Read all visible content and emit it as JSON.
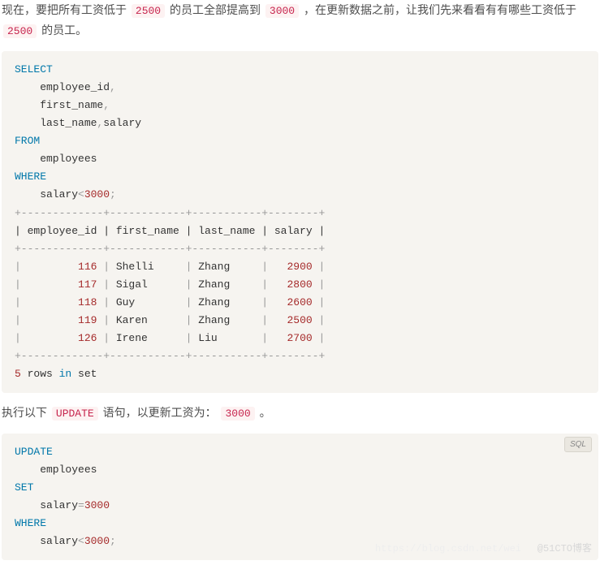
{
  "para1": {
    "t1": "现在，要把所有工资低于 ",
    "c1": "2500",
    "t2": " 的员工全部提高到 ",
    "c2": "3000",
    "t3": " ，在更新数据之前，让我们先来看看有有哪些工资低于 ",
    "c3": "2500",
    "t4": " 的员工。"
  },
  "sql1": {
    "kw_select": "SELECT",
    "col1": "    employee_id",
    "col2": "    first_name",
    "col3": "    last_name",
    "col3b": "salary",
    "kw_from": "FROM",
    "tbl": "    employees",
    "kw_where": "WHERE",
    "cond_l": "    salary",
    "cond_op": "<",
    "cond_r": "3000",
    "semicolon": ";",
    "comma": ","
  },
  "result": {
    "border_top": "+-------------+------------+-----------+--------+",
    "header": "| employee_id | first_name | last_name | salary |",
    "border_mid": "+-------------+------------+-----------+--------+",
    "rows": [
      {
        "id": "116",
        "fn": "Shelli",
        "ln": "Zhang",
        "sal": "2900"
      },
      {
        "id": "117",
        "fn": "Sigal",
        "ln": "Zhang",
        "sal": "2800"
      },
      {
        "id": "118",
        "fn": "Guy",
        "ln": "Zhang",
        "sal": "2600"
      },
      {
        "id": "119",
        "fn": "Karen",
        "ln": "Zhang",
        "sal": "2500"
      },
      {
        "id": "126",
        "fn": "Irene",
        "ln": "Liu",
        "sal": "2700"
      }
    ],
    "border_bot": "+-------------+------------+-----------+--------+",
    "footer_a": "5",
    "footer_b": " rows ",
    "footer_c": "in",
    "footer_d": " set"
  },
  "para2": {
    "t1": "执行以下 ",
    "c1": "UPDATE",
    "t2": " 语句，以更新工资为： ",
    "c2": "3000",
    "t3": " 。"
  },
  "sql2": {
    "tag": "SQL",
    "kw_update": "UPDATE",
    "tbl": "    employees",
    "kw_set": "SET",
    "set_l": "    salary",
    "set_eq": "=",
    "set_r": "3000",
    "kw_where": "WHERE",
    "cond_l": "    salary",
    "cond_op": "<",
    "cond_r": "3000",
    "semicolon": ";"
  },
  "watermark": "@51CTO博客",
  "watermark2": "https://blog.csdn.net/wei"
}
